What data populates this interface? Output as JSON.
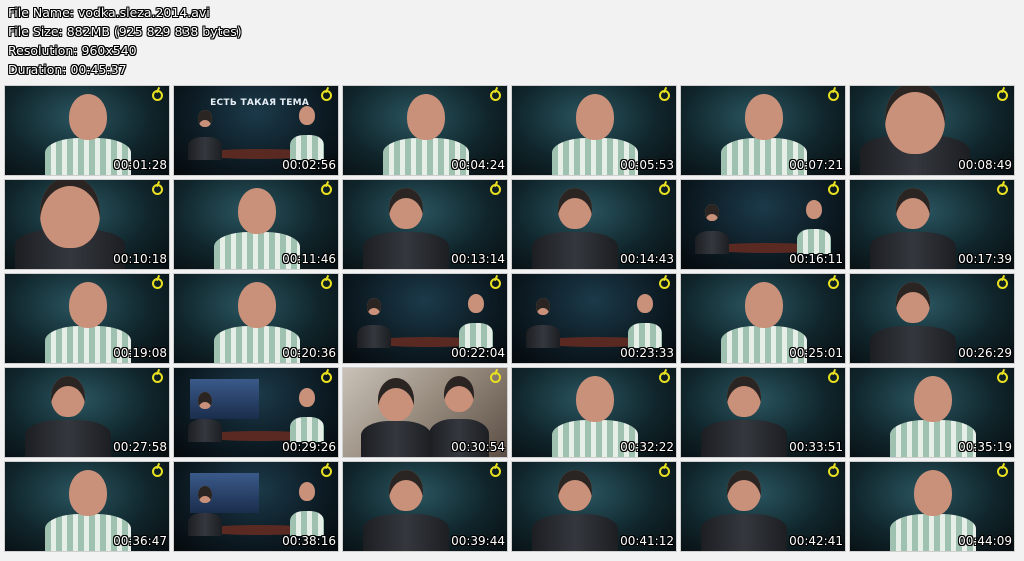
{
  "info": {
    "file_name": "File Name: vodka.sleza.2014.avi",
    "file_size": "File Size: 882MB (925 829 838 bytes)",
    "resolution": "Resolution: 960x540",
    "duration": "Duration: 00:45:37"
  },
  "studio_banner": "ЕСТЬ ТАКАЯ ТЕМА",
  "accent_colors": {
    "logo": "#e8e020",
    "bald_shirt": "#9fc2b0",
    "desk": "#5a2a22"
  },
  "thumbnails": [
    {
      "time": "00:01:28",
      "scene": "bald-man"
    },
    {
      "time": "00:02:56",
      "scene": "studio-banner"
    },
    {
      "time": "00:04:24",
      "scene": "bald-man"
    },
    {
      "time": "00:05:53",
      "scene": "bald-man"
    },
    {
      "time": "00:07:21",
      "scene": "bald-man"
    },
    {
      "time": "00:08:49",
      "scene": "dark-hair-closeup"
    },
    {
      "time": "00:10:18",
      "scene": "dark-hair-closeup"
    },
    {
      "time": "00:11:46",
      "scene": "bald-man"
    },
    {
      "time": "00:13:14",
      "scene": "dark-hair-man"
    },
    {
      "time": "00:14:43",
      "scene": "dark-hair-man"
    },
    {
      "time": "00:16:11",
      "scene": "studio-wide"
    },
    {
      "time": "00:17:39",
      "scene": "dark-hair-man"
    },
    {
      "time": "00:19:08",
      "scene": "bald-man"
    },
    {
      "time": "00:20:36",
      "scene": "bald-man"
    },
    {
      "time": "00:22:04",
      "scene": "studio-wide"
    },
    {
      "time": "00:23:33",
      "scene": "studio-wide"
    },
    {
      "time": "00:25:01",
      "scene": "bald-man"
    },
    {
      "time": "00:26:29",
      "scene": "dark-hair-man"
    },
    {
      "time": "00:27:58",
      "scene": "dark-hair-man"
    },
    {
      "time": "00:29:26",
      "scene": "studio-screen"
    },
    {
      "time": "00:30:54",
      "scene": "film-still"
    },
    {
      "time": "00:32:22",
      "scene": "bald-man"
    },
    {
      "time": "00:33:51",
      "scene": "dark-hair-man"
    },
    {
      "time": "00:35:19",
      "scene": "bald-man"
    },
    {
      "time": "00:36:47",
      "scene": "bald-man"
    },
    {
      "time": "00:38:16",
      "scene": "studio-screen"
    },
    {
      "time": "00:39:44",
      "scene": "dark-hair-man"
    },
    {
      "time": "00:41:12",
      "scene": "dark-hair-man"
    },
    {
      "time": "00:42:41",
      "scene": "dark-hair-man"
    },
    {
      "time": "00:44:09",
      "scene": "bald-man"
    }
  ]
}
